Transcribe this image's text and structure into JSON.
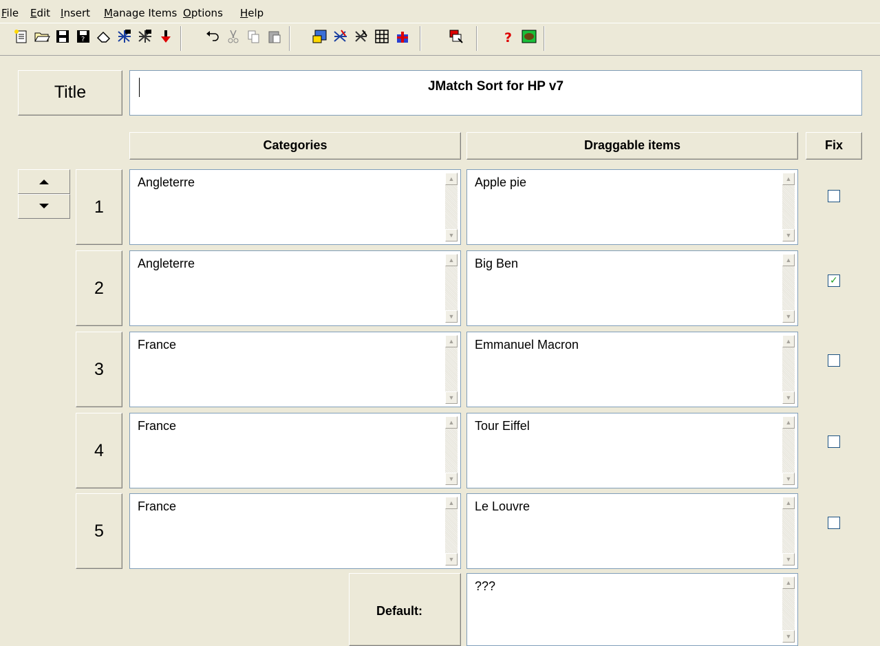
{
  "menu": [
    {
      "label": "File"
    },
    {
      "label": "Edit"
    },
    {
      "label": "Insert"
    },
    {
      "label": "Manage Items"
    },
    {
      "label": "Options"
    },
    {
      "label": "Help"
    }
  ],
  "toolbar": {
    "icons": [
      "new-file-icon",
      "open-folder-icon",
      "save-icon",
      "save-as-icon",
      "eraser-icon",
      "shuffle-icon",
      "shuffle-alt-icon",
      "download-arrow-icon",
      "undo-icon",
      "cut-icon",
      "copy-icon",
      "paste-icon",
      "export-web-icon",
      "export-drag-icon",
      "export-alt-icon",
      "table-icon",
      "gift-icon",
      "config-icon",
      "help-icon",
      "watch-icon"
    ]
  },
  "title": {
    "label": "Title",
    "value": "JMatch Sort for HP v7"
  },
  "headers": {
    "categories": "Categories",
    "items": "Draggable items",
    "fix": "Fix"
  },
  "rows": [
    {
      "num": "1",
      "category": "Angleterre",
      "item": "Apple pie",
      "fixed": false
    },
    {
      "num": "2",
      "category": "Angleterre",
      "item": "Big Ben",
      "fixed": true
    },
    {
      "num": "3",
      "category": "France",
      "item": "Emmanuel Macron",
      "fixed": false
    },
    {
      "num": "4",
      "category": "France",
      "item": "Tour Eiffel",
      "fixed": false
    },
    {
      "num": "5",
      "category": "France",
      "item": "Le Louvre",
      "fixed": false
    }
  ],
  "default": {
    "label": "Default:",
    "value": "???"
  },
  "colors": {
    "background": "#ece9d8",
    "input_border": "#7f9db9",
    "check": "#21a121"
  }
}
